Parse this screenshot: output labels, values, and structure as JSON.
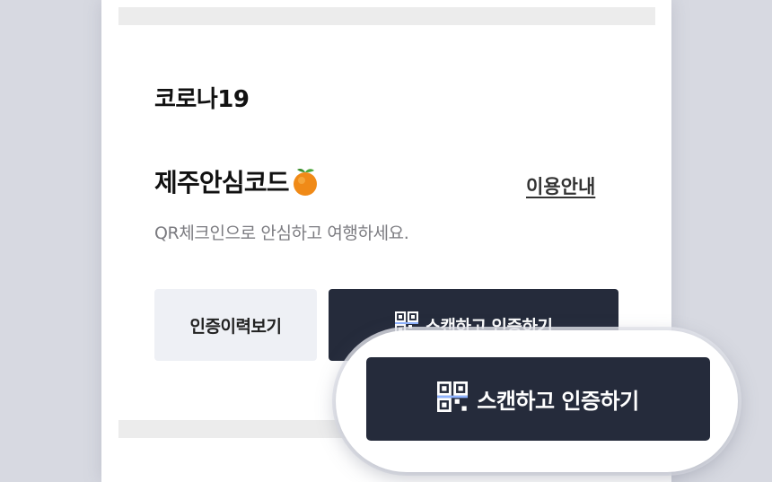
{
  "section": {
    "title": "코로나19"
  },
  "safe_code": {
    "title": "제주안심코드",
    "title_icon": "tangerine-icon",
    "guide_link": "이용안내",
    "description": "QR체크인으로 안심하고 여행하세요."
  },
  "buttons": {
    "history_label": "인증이력보기",
    "scan_label": "스캔하고 인증하기",
    "scan_icon": "qr-code-icon"
  },
  "colors": {
    "primary_button": "#252b3b",
    "secondary_button": "#eef0f5",
    "background": "#d7d9e1",
    "description_text": "#7b7b80"
  }
}
